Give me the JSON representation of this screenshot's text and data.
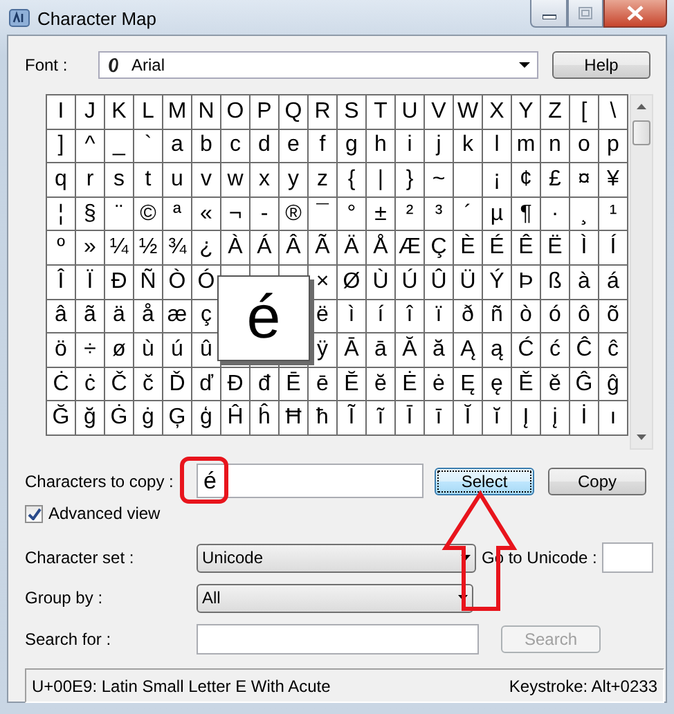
{
  "window": {
    "title": "Character Map"
  },
  "font": {
    "label": "Font :",
    "value": "Arial"
  },
  "help_button": {
    "label": "Help"
  },
  "grid": {
    "rows": [
      [
        "I",
        "J",
        "K",
        "L",
        "M",
        "N",
        "O",
        "P",
        "Q",
        "R",
        "S",
        "T",
        "U",
        "V",
        "W",
        "X",
        "Y",
        "Z",
        "[",
        "\\"
      ],
      [
        "]",
        "^",
        "_",
        "`",
        "a",
        "b",
        "c",
        "d",
        "e",
        "f",
        "g",
        "h",
        "i",
        "j",
        "k",
        "l",
        "m",
        "n",
        "o",
        "p"
      ],
      [
        "q",
        "r",
        "s",
        "t",
        "u",
        "v",
        "w",
        "x",
        "y",
        "z",
        "{",
        "|",
        "}",
        "~",
        null,
        "¡",
        "¢",
        "£",
        "¤",
        "¥"
      ],
      [
        "¦",
        "§",
        "¨",
        "©",
        "ª",
        "«",
        "¬",
        "-",
        "®",
        "¯",
        "°",
        "±",
        "²",
        "³",
        "´",
        "µ",
        "¶",
        "·",
        "¸",
        "¹"
      ],
      [
        "º",
        "»",
        "¼",
        "½",
        "¾",
        "¿",
        "À",
        "Á",
        "Â",
        "Ã",
        "Ä",
        "Å",
        "Æ",
        "Ç",
        "È",
        "É",
        "Ê",
        "Ë",
        "Ì",
        "Í"
      ],
      [
        "Î",
        "Ï",
        "Ð",
        "Ñ",
        "Ò",
        "Ó",
        null,
        null,
        null,
        "×",
        "Ø",
        "Ù",
        "Ú",
        "Û",
        "Ü",
        "Ý",
        "Þ",
        "ß",
        "à",
        "á"
      ],
      [
        "â",
        "ã",
        "ä",
        "å",
        "æ",
        "ç",
        null,
        null,
        null,
        "ë",
        "ì",
        "í",
        "î",
        "ï",
        "ð",
        "ñ",
        "ò",
        "ó",
        "ô",
        "õ"
      ],
      [
        "ö",
        "÷",
        "ø",
        "ù",
        "ú",
        "û",
        null,
        null,
        null,
        "ÿ",
        "Ā",
        "ā",
        "Ă",
        "ă",
        "Ą",
        "ą",
        "Ć",
        "ć",
        "Ĉ",
        "ĉ"
      ],
      [
        "Ċ",
        "ċ",
        "Č",
        "č",
        "Ď",
        "ď",
        "Đ",
        "đ",
        "Ē",
        "ē",
        "Ĕ",
        "ĕ",
        "Ė",
        "ė",
        "Ę",
        "ę",
        "Ě",
        "ě",
        "Ĝ",
        "ĝ"
      ],
      [
        "Ğ",
        "ğ",
        "Ġ",
        "ġ",
        "Ģ",
        "ģ",
        "Ĥ",
        "ĥ",
        "Ħ",
        "ħ",
        "Ĩ",
        "ĩ",
        "Ī",
        "ī",
        "Ĭ",
        "ĭ",
        "Į",
        "į",
        "İ",
        "ı"
      ]
    ]
  },
  "magnified_char": "é",
  "characters_to_copy": {
    "label": "Characters to copy :",
    "value": "é"
  },
  "select_button": {
    "label": "Select"
  },
  "copy_button": {
    "label": "Copy"
  },
  "advanced_view": {
    "label": "Advanced view",
    "checked": true
  },
  "character_set": {
    "label": "Character set :",
    "value": "Unicode"
  },
  "go_to_unicode": {
    "label": "Go to Unicode :"
  },
  "group_by": {
    "label": "Group by :",
    "value": "All"
  },
  "search_for": {
    "label": "Search for :"
  },
  "search_button": {
    "label": "Search",
    "disabled": true
  },
  "status_bar": {
    "description": "U+00E9: Latin Small Letter E With Acute",
    "keystroke": "Keystroke: Alt+0233"
  }
}
